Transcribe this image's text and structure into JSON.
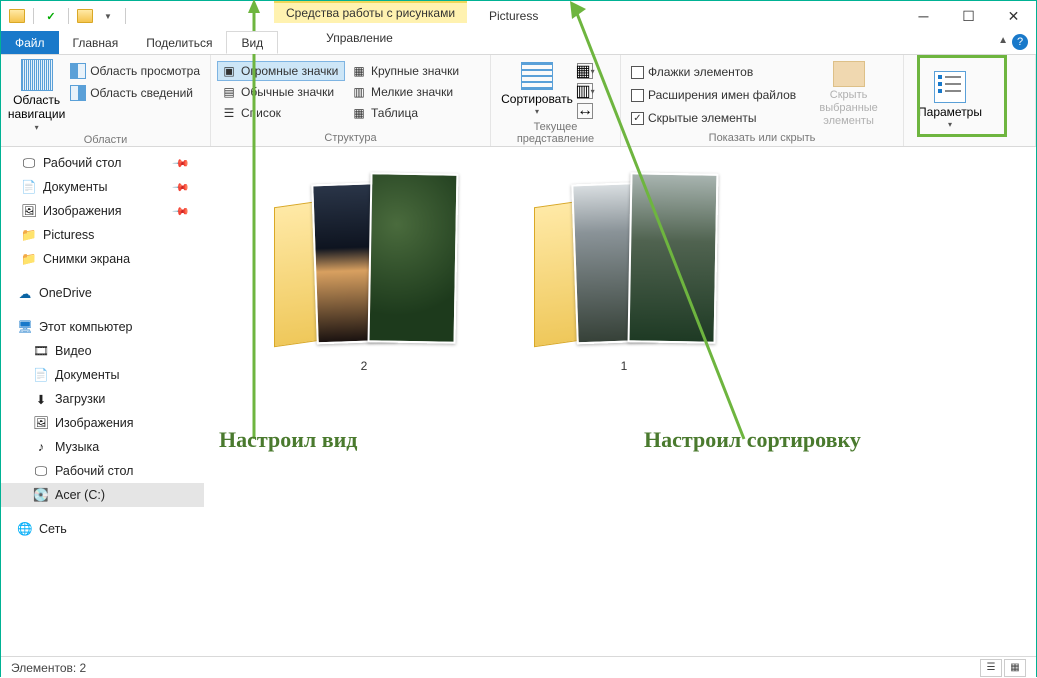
{
  "window": {
    "contextual_tab": "Средства работы с рисунками",
    "title": "Picturess"
  },
  "tabs": {
    "file": "Файл",
    "home": "Главная",
    "share": "Поделиться",
    "view": "Вид",
    "manage": "Управление"
  },
  "ribbon": {
    "panes": {
      "navigation": "Область навигации",
      "preview": "Область просмотра",
      "details": "Область сведений",
      "group": "Области"
    },
    "layout": {
      "huge": "Огромные значки",
      "large": "Крупные значки",
      "medium": "Обычные значки",
      "small": "Мелкие значки",
      "list": "Список",
      "table": "Таблица",
      "group": "Структура"
    },
    "sort": {
      "label": "Сортировать",
      "group": "Текущее представление"
    },
    "show": {
      "checkboxes": "Флажки элементов",
      "extensions": "Расширения имен файлов",
      "hidden": "Скрытые элементы",
      "hide_selected": "Скрыть выбранные элементы",
      "group": "Показать или скрыть"
    },
    "options": "Параметры"
  },
  "nav": {
    "quick": [
      {
        "label": "Рабочий стол",
        "pinned": true,
        "ico": "desktop"
      },
      {
        "label": "Документы",
        "pinned": true,
        "ico": "doc"
      },
      {
        "label": "Изображения",
        "pinned": true,
        "ico": "pic"
      },
      {
        "label": "Picturess",
        "pinned": false,
        "ico": "folder"
      },
      {
        "label": "Снимки экрана",
        "pinned": false,
        "ico": "folder"
      }
    ],
    "onedrive": "OneDrive",
    "thispc": {
      "label": "Этот компьютер",
      "children": [
        {
          "label": "Видео",
          "ico": "video"
        },
        {
          "label": "Документы",
          "ico": "doc"
        },
        {
          "label": "Загрузки",
          "ico": "dl"
        },
        {
          "label": "Изображения",
          "ico": "pic"
        },
        {
          "label": "Музыка",
          "ico": "music"
        },
        {
          "label": "Рабочий стол",
          "ico": "desktop"
        },
        {
          "label": "Acer (C:)",
          "ico": "drive",
          "selected": true
        }
      ]
    },
    "network": "Сеть"
  },
  "folders": [
    {
      "name": "2"
    },
    {
      "name": "1"
    }
  ],
  "annotations": {
    "view": "Настроил вид",
    "sort": "Настроил сортировку"
  },
  "status": {
    "count_label": "Элементов:",
    "count": "2"
  },
  "colors": {
    "accent": "#1979ca",
    "annotation": "#4a7a2e",
    "highlight": "#6eb53f"
  }
}
